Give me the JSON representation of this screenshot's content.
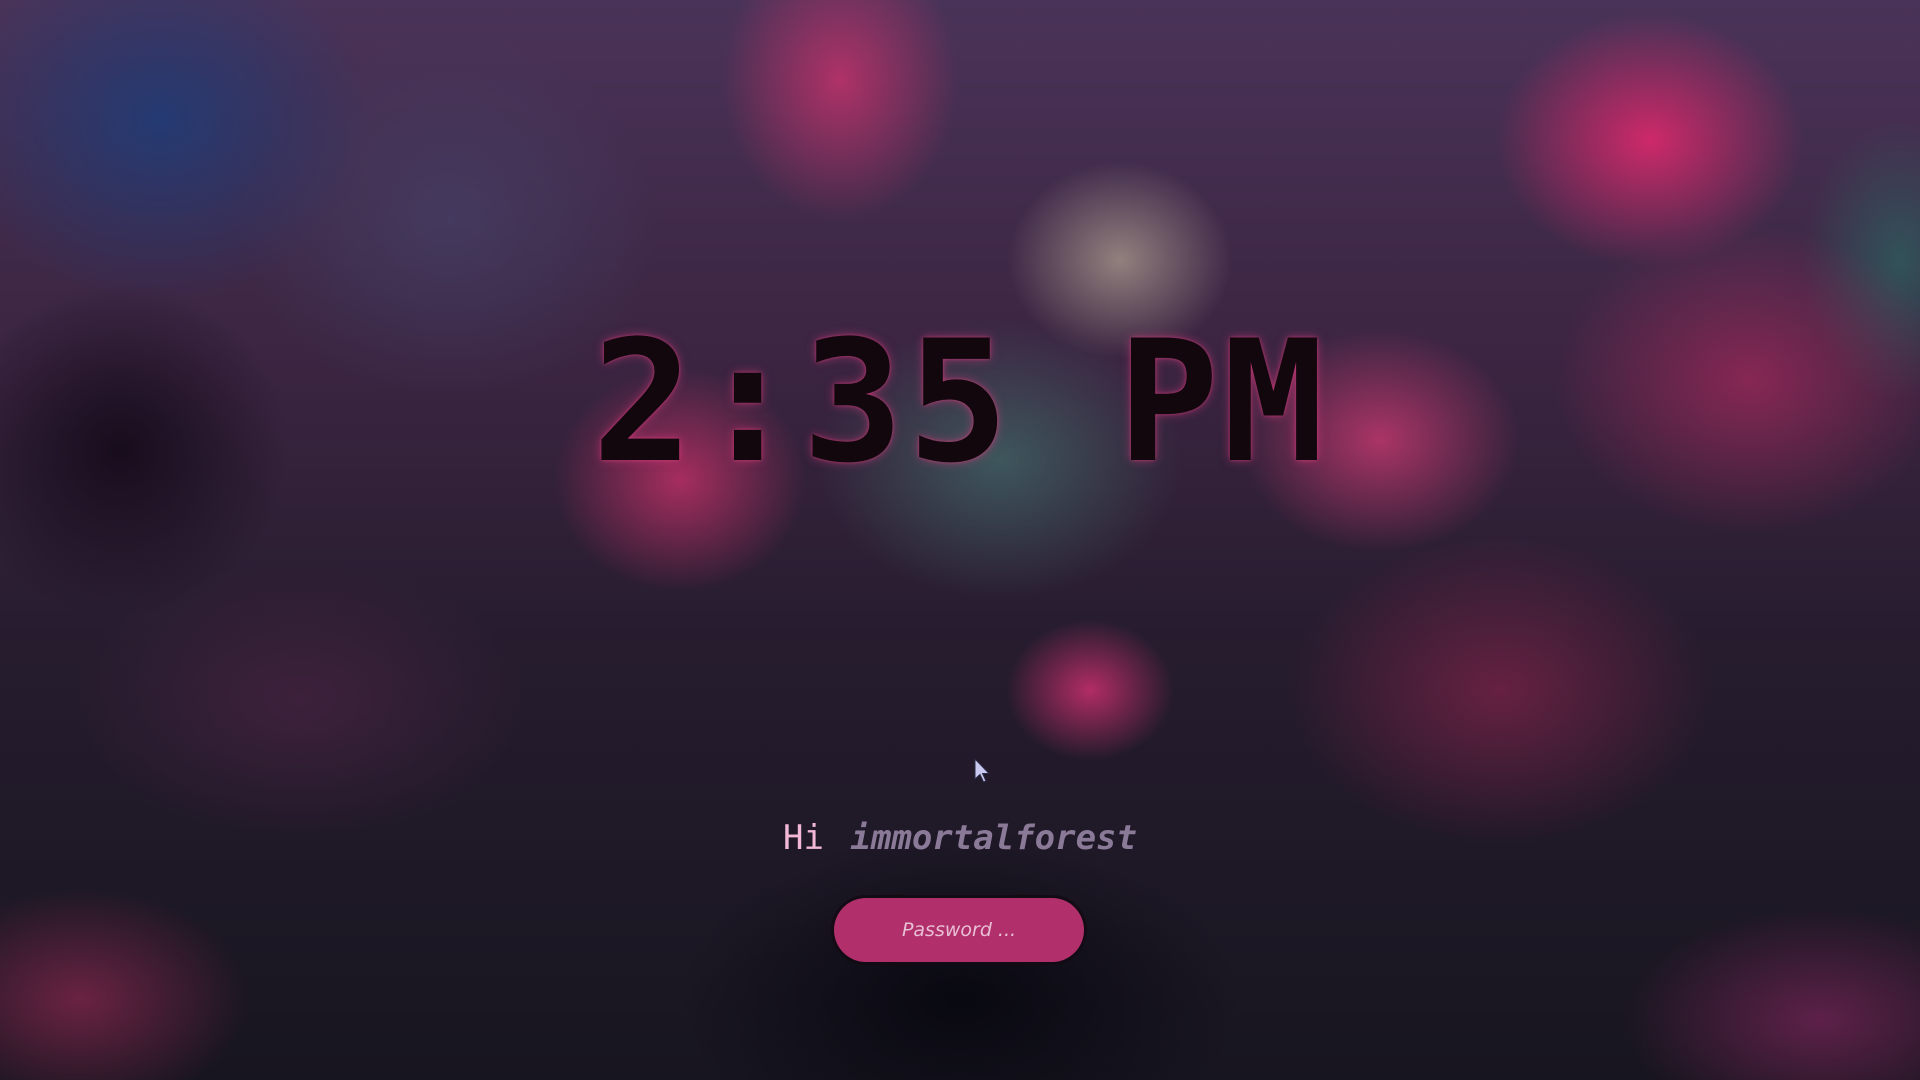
{
  "clock": {
    "time": "2:35 PM"
  },
  "greeting": {
    "prefix": "Hi",
    "username": "immortalforest"
  },
  "password": {
    "placeholder": "Password ...",
    "value": ""
  },
  "colors": {
    "accent": "#b1306c",
    "greeting_prefix": "#f2b8d6",
    "username": "#8a7a98",
    "clock_text": "#12070d"
  },
  "icons": {
    "cursor": "mouse-pointer-icon"
  }
}
